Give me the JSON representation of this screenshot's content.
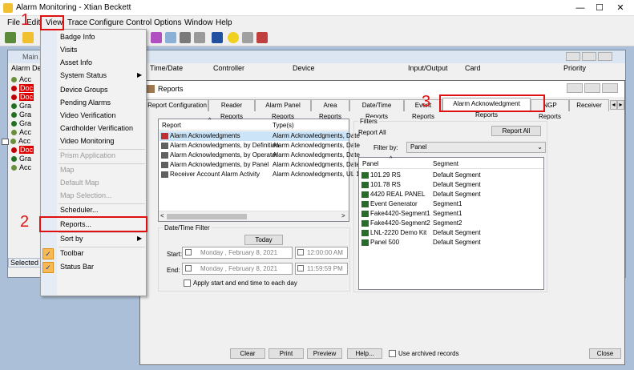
{
  "app": {
    "title": "Alarm Monitoring - Xtian Beckett"
  },
  "window_controls": {
    "minimize": "—",
    "maximize": "☐",
    "close": "✕"
  },
  "menu": [
    "File",
    "Edit",
    "View",
    "Trace",
    "Configure",
    "Control",
    "Options",
    "Window",
    "Help"
  ],
  "main_window": {
    "title": "Main A",
    "columns": [
      "Alarm Des",
      "Time/Date",
      "Controller",
      "Device",
      "Input/Output",
      "Card",
      "Priority"
    ],
    "tree": [
      "Acc",
      "Doc",
      "Doc",
      "Gra",
      "Gra",
      "Gra",
      "Acc",
      "Acc",
      "Doc",
      "Gra",
      "Acc"
    ],
    "status": "Selected al"
  },
  "view_menu": {
    "items": [
      {
        "label": "Badge Info"
      },
      {
        "label": "Visits"
      },
      {
        "label": "Asset Info"
      },
      {
        "label": "System Status"
      },
      {
        "label": "Device Groups"
      },
      {
        "label": "Pending Alarms"
      },
      {
        "label": "Video Verification"
      },
      {
        "label": "Cardholder Verification"
      },
      {
        "label": "Video Monitoring"
      },
      {
        "label": "Prism Application"
      },
      {
        "label": "Map"
      },
      {
        "label": "Default Map"
      },
      {
        "label": "Map Selection..."
      },
      {
        "label": "Scheduler..."
      },
      {
        "label": "Reports..."
      },
      {
        "label": "Sort by"
      },
      {
        "label": "Toolbar"
      },
      {
        "label": "Status Bar"
      }
    ]
  },
  "reports": {
    "title": "Reports",
    "tabs": [
      "Report Configuration",
      "Reader Reports",
      "Alarm Panel Reports",
      "Area Reports",
      "Date/Time Reports",
      "Event Reports",
      "Alarm Acknowledgment Reports",
      "NGP Reports",
      "Receiver Acco"
    ],
    "list_headers": [
      "Report",
      "Type(s)"
    ],
    "list_rows": [
      {
        "report": "Alarm Acknowledgments",
        "type": "Alarm Acknowledgments, Date"
      },
      {
        "report": "Alarm Acknowledgments, by Definition",
        "type": "Alarm Acknowledgments, Date"
      },
      {
        "report": "Alarm Acknowledgments, by Operator",
        "type": "Alarm Acknowledgments, Date"
      },
      {
        "report": "Alarm Acknowledgments, by Panel",
        "type": "Alarm Acknowledgments, Date"
      },
      {
        "report": "Receiver Account Alarm Activity",
        "type": "Alarm Acknowledgments, UL 1"
      }
    ],
    "datetime": {
      "group": "Date/Time Filter",
      "today": "Today",
      "start_label": "Start:",
      "end_label": "End:",
      "start_date": "Monday    ,  February   8, 2021",
      "end_date": "Monday    ,  February   8, 2021",
      "start_time": "12:00:00 AM",
      "end_time": "11:59:59 PM",
      "apply_label": "Apply start and end time to each day"
    },
    "filters": {
      "group": "Filters",
      "report_all_label": "Report All",
      "report_all_button": "Report All",
      "filter_by_label": "Filter by:",
      "filter_by_value": "Panel",
      "headers": [
        "Panel",
        "Segment"
      ],
      "rows": [
        {
          "panel": "101.29 RS",
          "segment": "Default Segment"
        },
        {
          "panel": "101.78 RS",
          "segment": "Default Segment"
        },
        {
          "panel": "4420 REAL PANEL",
          "segment": "Default Segment"
        },
        {
          "panel": "Event Generator",
          "segment": "Segment1"
        },
        {
          "panel": "Fake4420-Segment1",
          "segment": "Segment1"
        },
        {
          "panel": "Fake4420-Segment2",
          "segment": "Segment2"
        },
        {
          "panel": "LNL-2220 Demo Kit",
          "segment": "Default Segment"
        },
        {
          "panel": "Panel 500",
          "segment": "Default Segment"
        }
      ]
    },
    "buttons": {
      "clear": "Clear",
      "print": "Print",
      "preview": "Preview",
      "help": "Help...",
      "archived": "Use archived records",
      "close": "Close"
    }
  },
  "callouts": [
    "1",
    "2",
    "3"
  ]
}
